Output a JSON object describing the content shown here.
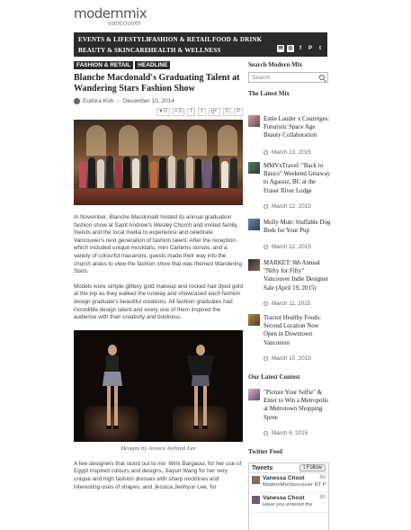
{
  "logo": {
    "main": "modernmix",
    "sub": "vancouver"
  },
  "nav": {
    "items": [
      "EVENTS & LIFESTYLE",
      "FASHION & RETAIL",
      "FOOD & DRINK",
      "BEAUTY & SKINCARE",
      "HEALTH & WELLNESS"
    ],
    "icons": [
      "email-icon",
      "instagram-icon",
      "facebook-icon",
      "pinterest-icon",
      "twitter-icon"
    ]
  },
  "article": {
    "tags": [
      "FASHION & RETAIL",
      "HEADLINE"
    ],
    "title": "Blanche Macdonald's Graduating Talent at Wandering Stars Fashion Show",
    "author": "Eudora Koh",
    "separator": "—",
    "date": "December 10, 2014",
    "share": {
      "likes": "0",
      "comments": "0",
      "gplus": "0"
    },
    "paragraph1": "In November, Blanche Macdonald hosted its annual graduation fashion show at Saint Andrew's Wesley Church and invited family, friends and the local media to experience and celebrate Vancouver's next generation of fashion talent. After the reception which included unique mocktails, mini Cartems donuts, and a variety of colourful macarons, guests made their way into the church aisles to view the fashion show that was themed Wandering Stars.",
    "paragraph2": "Models wore simple glittery gold makeup and rocked hair dyed gold at the top as they walked the runway and showcased each fashion design graduate's beautiful creations. All fashion graduates had incredible design talent and every one of them inspired the audience with their creativity and boldness.",
    "caption": "Designs by Jessica Jeehyun Lee",
    "paragraph3": "A few designers that stood out to me: Mimi Bargaoui, for her use of Egypt inspired colours and designs, Jiayun Wang for her very unique and high fashion dresses with sharp necklines and interesting uses of shapes, and Jessica Jeehyun Lee, for"
  },
  "sidebar": {
    "search_heading": "Search Modern Mix",
    "search_placeholder": "Search",
    "latest_heading": "The Latest Mix",
    "latest": [
      {
        "title": "Estée Lauder x Courrèges: Futuristic Space Age Beauty Collaboration",
        "date": "March 13, 2015"
      },
      {
        "title": "MMVxTravel: \"Back to Basics\" Weekend Getaway to Agassiz, BC at the Fraser River Lodge",
        "date": "March 12, 2015"
      },
      {
        "title": "Molly Mutt: Stuffable Dog Beds for Your Pup",
        "date": "March 12, 2015"
      },
      {
        "title": "MARKET: 8th Annual \"Nifty for Fifty\" Vancouver Indie Designer Sale (April 19, 2015)",
        "date": "March 11, 2015"
      },
      {
        "title": "Tractor Healthy Foods: Second Location Now Open in Downtown Vancouver",
        "date": "March 10, 2015"
      }
    ],
    "contest_heading": "Our Latest Contest",
    "contest": {
      "title": "\"Picture Your Selfie\" & Enter to Win a Metropolis at Metrotown Shopping Spree",
      "date": "March 6, 2015"
    },
    "twitter_heading": "Twitter Feed",
    "twitter": {
      "label": "Tweets",
      "follow": "Follow",
      "tweets": [
        {
          "name": "Vanessa Choot",
          "time": "6h",
          "text": "ModernMixVancouver RT Pam Sinni ... Fxhairt"
        },
        {
          "name": "Vanessa Choot",
          "time": "8h",
          "text": "Have you entered the"
        }
      ]
    }
  },
  "colors": {
    "nav_bg": "#2b2b2b",
    "accent": "#2b2b2b"
  }
}
